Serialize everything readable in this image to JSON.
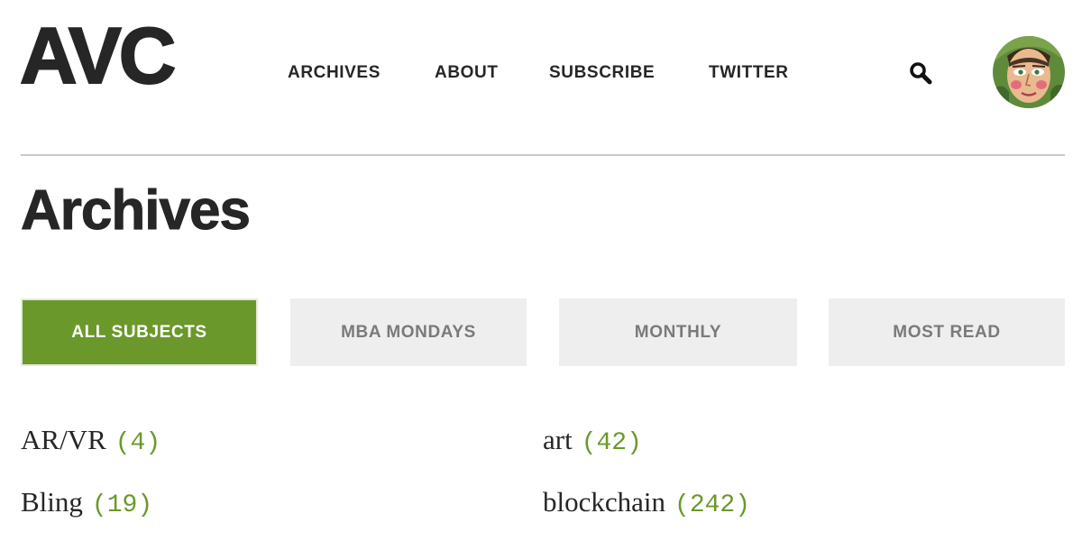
{
  "header": {
    "logo_text": "AVC",
    "nav": [
      {
        "label": "ARCHIVES"
      },
      {
        "label": "ABOUT"
      },
      {
        "label": "SUBSCRIBE"
      },
      {
        "label": "TWITTER"
      }
    ],
    "search_icon": "search-icon",
    "avatar_icon": "avatar"
  },
  "page": {
    "title": "Archives"
  },
  "tabs": [
    {
      "label": "ALL SUBJECTS",
      "active": true
    },
    {
      "label": "MBA MONDAYS",
      "active": false
    },
    {
      "label": "MONTHLY",
      "active": false
    },
    {
      "label": "MOST READ",
      "active": false
    }
  ],
  "subjects": [
    {
      "name": "AR/VR",
      "count": "(4)"
    },
    {
      "name": "art",
      "count": "(42)"
    },
    {
      "name": "Bling",
      "count": "(19)"
    },
    {
      "name": "blockchain",
      "count": "(242)"
    }
  ],
  "colors": {
    "accent": "#6b982b",
    "text": "#262626",
    "tab_inactive_bg": "#eeeeee",
    "tab_inactive_text": "#7a7a7a",
    "divider": "#c9c9c9"
  }
}
